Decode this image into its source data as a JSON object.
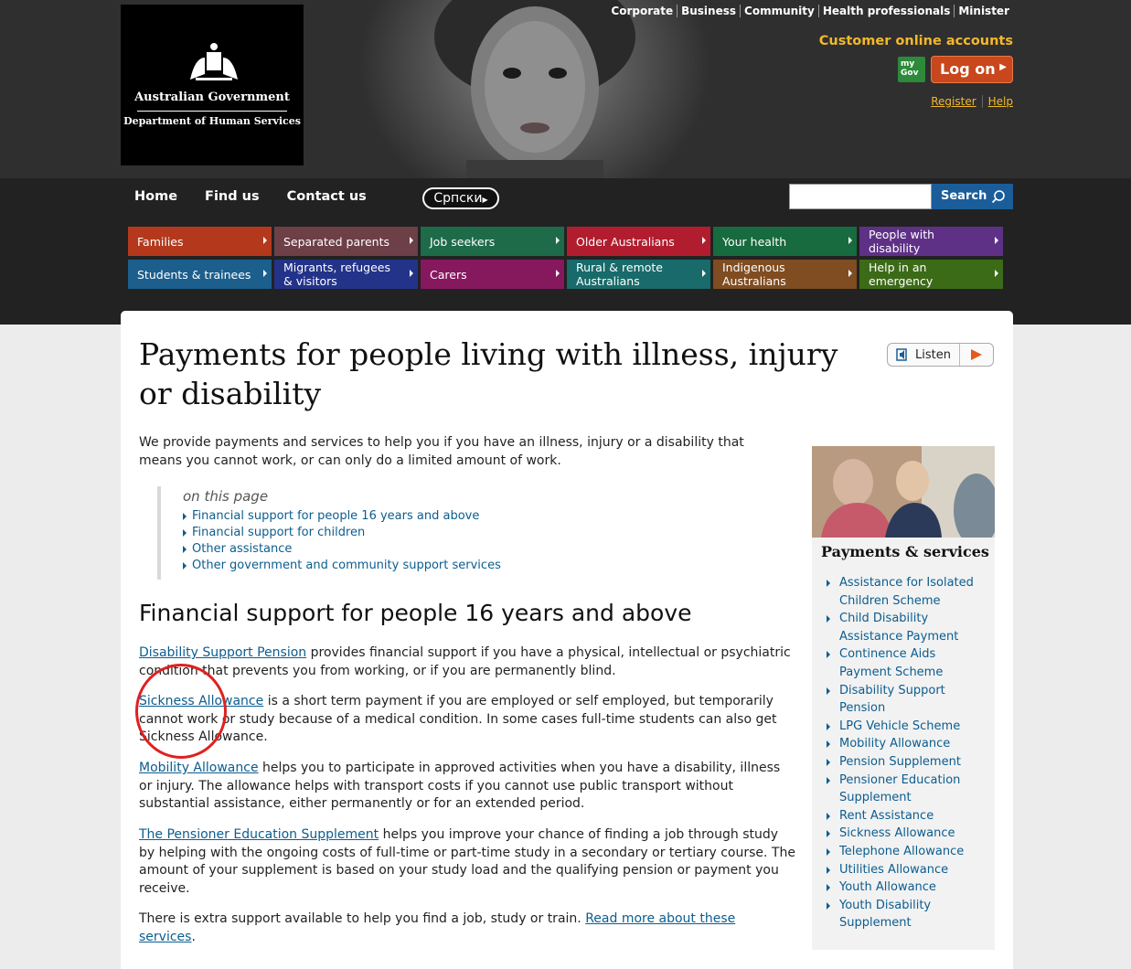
{
  "header": {
    "logo": {
      "government": "Australian Government",
      "department": "Department of Human Services"
    },
    "top_links": [
      "Corporate",
      "Business",
      "Community",
      "Health professionals",
      "Minister"
    ],
    "customer_accounts_label": "Customer online accounts",
    "mygov_label": "my Gov",
    "logon_label": "Log on",
    "register_label": "Register",
    "help_label": "Help"
  },
  "nav": {
    "items": [
      "Home",
      "Find us",
      "Contact us"
    ],
    "language_label": "Српски",
    "search_placeholder": "",
    "search_label": "Search"
  },
  "categories": [
    {
      "label": "Families",
      "color": "#b4391c"
    },
    {
      "label": "Separated parents",
      "color": "#6d3f47"
    },
    {
      "label": "Job seekers",
      "color": "#1e6b4a"
    },
    {
      "label": "Older Australians",
      "color": "#b11d2e"
    },
    {
      "label": "Your health",
      "color": "#176b3e"
    },
    {
      "label": "People with disability",
      "color": "#5e3186"
    },
    {
      "label": "Students & trainees",
      "color": "#1c5e8c"
    },
    {
      "label": "Migrants, refugees & visitors",
      "color": "#23338a"
    },
    {
      "label": "Carers",
      "color": "#86185e"
    },
    {
      "label": "Rural & remote Australians",
      "color": "#186b6a"
    },
    {
      "label": "Indigenous Australians",
      "color": "#7f4d21"
    },
    {
      "label": "Help in an emergency",
      "color": "#3c6b18"
    }
  ],
  "main": {
    "title": "Payments for people living with illness, injury or disability",
    "listen_label": "Listen",
    "intro": "We provide payments and services to help you if you have an illness, injury or a disability that means you cannot work, or can only do a limited amount of work.",
    "on_this_page": {
      "title": "on this page",
      "items": [
        "Financial support for people 16 years and above",
        "Financial support for children",
        "Other assistance",
        "Other government and community support services"
      ]
    },
    "section_heading": "Financial support for people 16 years and above",
    "paragraphs": [
      {
        "link": "Disability Support Pension",
        "text": " provides financial support if you have a physical, intellectual or psychiatric condition that prevents you from working, or if you are permanently blind."
      },
      {
        "link": "Sickness Allowance",
        "text": " is a short term payment if you are employed or self employed, but temporarily cannot work or study because of a medical condition. In some cases full-time students can also get Sickness Allowance."
      },
      {
        "link": "Mobility Allowance",
        "text": " helps you to participate in approved activities when you have a disability, illness or injury. The allowance helps with transport costs if you cannot use public transport without substantial assistance, either permanently or for an extended period."
      },
      {
        "link": "The Pensioner Education Supplement",
        "text": " helps you improve your chance of finding a job through study by helping with the ongoing costs of full-time or part-time study in a secondary or tertiary course. The amount of your supplement is based on your study load and the qualifying pension or payment you receive."
      }
    ],
    "extra": {
      "text": "There is extra support available to help you find a job, study or train. ",
      "link": "Read more about these services",
      "end": "."
    }
  },
  "sidebar": {
    "title": "Payments & services",
    "items": [
      "Assistance for Isolated Children Scheme",
      "Child Disability Assistance Payment",
      "Continence Aids Payment Scheme",
      "Disability Support Pension",
      "LPG Vehicle Scheme",
      "Mobility Allowance",
      "Pension Supplement",
      "Pensioner Education Supplement",
      "Rent Assistance",
      "Sickness Allowance",
      "Telephone Allowance",
      "Utilities Allowance",
      "Youth Allowance",
      "Youth Disability Supplement"
    ]
  }
}
